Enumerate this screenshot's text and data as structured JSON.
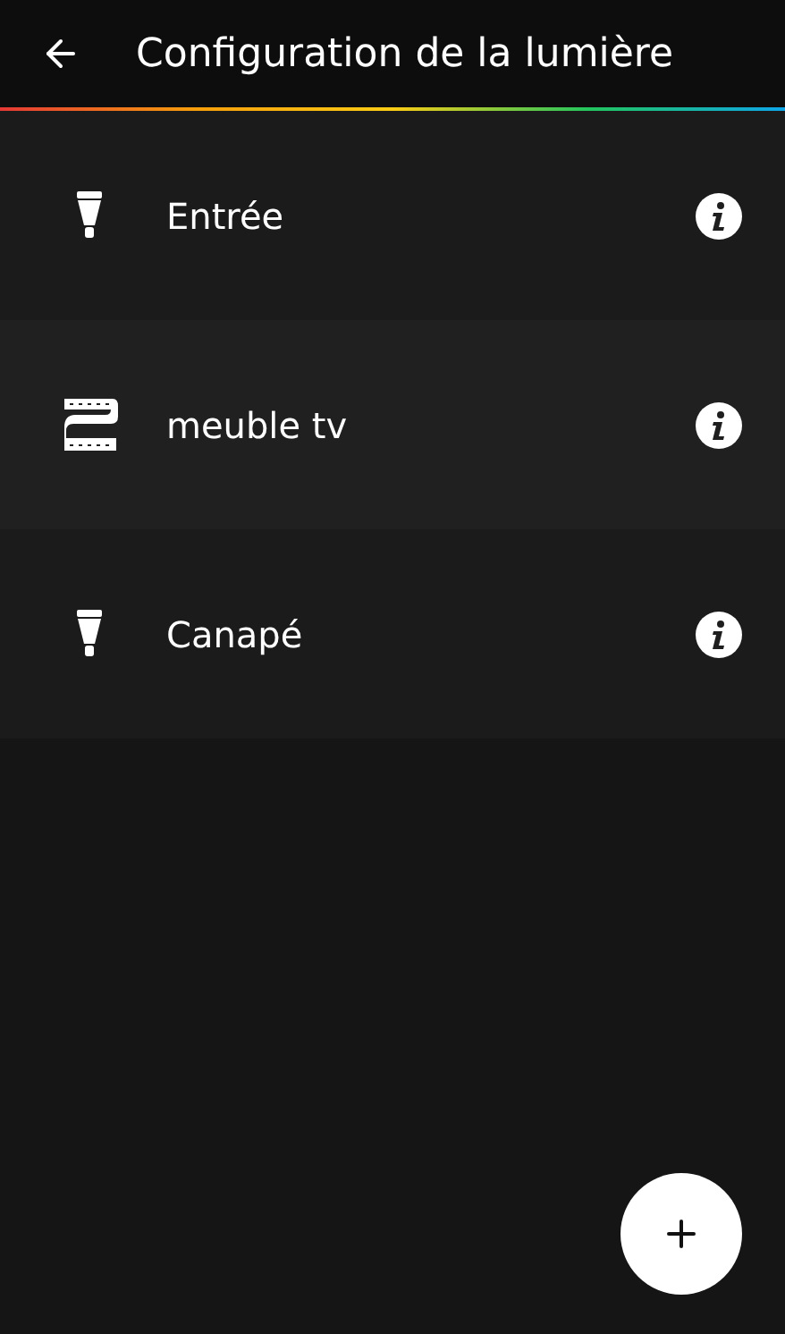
{
  "header": {
    "title": "Configuration de la lumière"
  },
  "lights": [
    {
      "name": "Entrée",
      "kind": "bulb"
    },
    {
      "name": "meuble tv",
      "kind": "lightstrip"
    },
    {
      "name": "Canapé",
      "kind": "bulb"
    }
  ]
}
